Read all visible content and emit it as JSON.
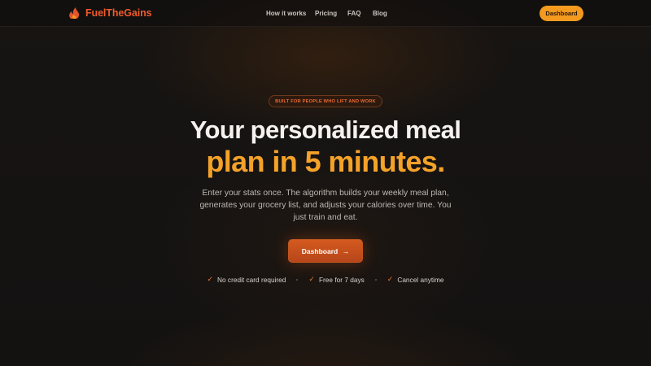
{
  "brand": {
    "name": "FuelTheGains",
    "logo_icon": "flame-muscle-icon",
    "color": "#ee5a2b"
  },
  "nav": {
    "links": [
      "How it works",
      "Pricing",
      "FAQ",
      "Blog"
    ],
    "cta_label": "Dashboard"
  },
  "hero": {
    "badge": "BUILT FOR PEOPLE WHO LIFT AND WORK",
    "title_line1": "Your personalized meal",
    "title_line2": "plan in 5 minutes.",
    "subtitle": "Enter your stats once. The algorithm builds your weekly meal plan, generates your grocery list, and adjusts your calories over time. You just train and eat.",
    "cta_label": "Dashboard",
    "cta_icon": "arrow-right-icon"
  },
  "perks": [
    "No credit card required",
    "Free for 7 days",
    "Cancel anytime"
  ],
  "colors": {
    "accent": "#f39a1f",
    "cta": "#c9501d",
    "background": "#131211"
  }
}
